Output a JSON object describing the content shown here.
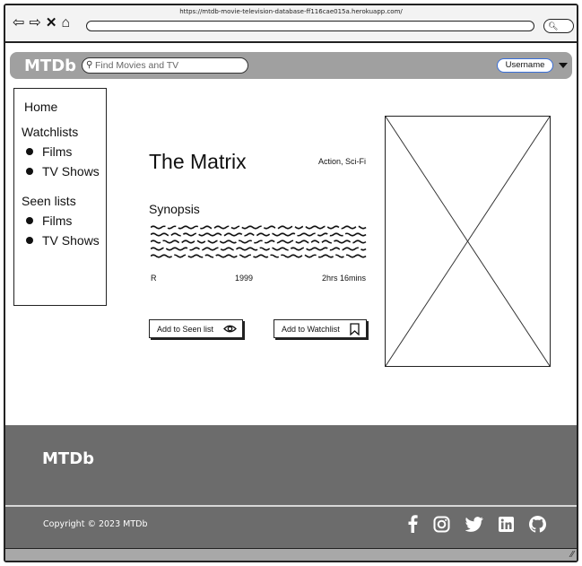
{
  "browser": {
    "url": "https://mtdb-movie-television-database-ff116cae015a.herokuapp.com/",
    "nav_icons": [
      "back-arrow-icon",
      "forward-arrow-icon",
      "close-icon",
      "home-icon"
    ]
  },
  "navbar": {
    "brand": "MTDb",
    "search_placeholder": "Find Movies and TV",
    "username": "Username",
    "accent": "#3a6fd8",
    "bar_color": "#a0a0a0"
  },
  "sidebar": {
    "home": "Home",
    "watchlists": {
      "label": "Watchlists",
      "items": [
        "Films",
        "TV Shows"
      ]
    },
    "seen_lists": {
      "label": "Seen lists",
      "items": [
        "Films",
        "TV Shows"
      ]
    }
  },
  "movie": {
    "title": "The Matrix",
    "genres": "Action, Sci-Fi",
    "synopsis_heading": "Synopsis",
    "rating": "R",
    "year": "1999",
    "runtime": "2hrs 16mins"
  },
  "actions": {
    "add_seen": "Add to Seen list",
    "add_watchlist": "Add to Watchlist"
  },
  "footer": {
    "brand": "MTDb",
    "copyright": "Copyright © 2023 MTDb",
    "socials": [
      "facebook-icon",
      "instagram-icon",
      "twitter-icon",
      "linkedin-icon",
      "github-icon"
    ],
    "bg_color": "#6c6c6c"
  }
}
